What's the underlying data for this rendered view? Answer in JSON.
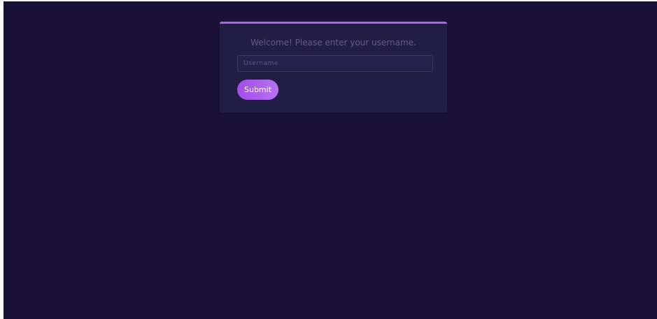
{
  "login": {
    "welcome_text": "Welcome! Please enter your username.",
    "username_placeholder": "Username",
    "username_value": "",
    "submit_label": "Submit"
  },
  "colors": {
    "background": "#191236",
    "card": "#221e43",
    "accent": "#a867e8",
    "button": "#a24ce8"
  }
}
